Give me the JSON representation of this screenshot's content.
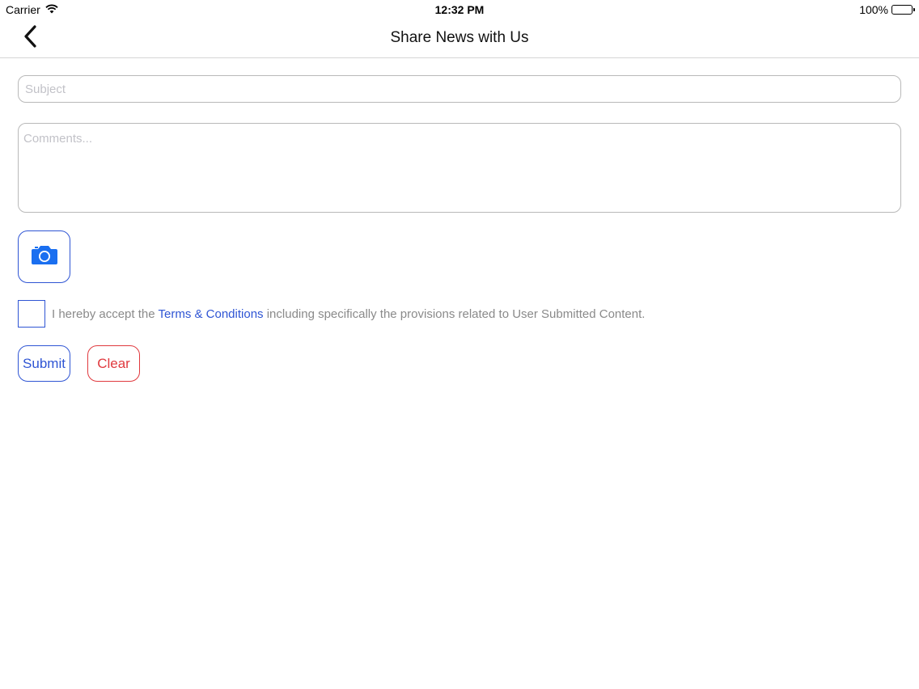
{
  "status_bar": {
    "carrier": "Carrier",
    "time": "12:32 PM",
    "battery": "100%",
    "battery_level": 1.0
  },
  "nav": {
    "title": "Share News with Us",
    "back_icon": "chevron-left-icon"
  },
  "form": {
    "subject_placeholder": "Subject",
    "subject_value": "",
    "comments_placeholder": "Comments...",
    "comments_value": "",
    "camera_icon": "camera-icon",
    "terms_prefix": "I hereby accept the ",
    "terms_link": "Terms & Conditions",
    "terms_suffix": " including specifically the provisions related to User Submitted Content.",
    "terms_checked": false,
    "submit_label": "Submit",
    "clear_label": "Clear"
  },
  "colors": {
    "accent": "#2f55d4",
    "danger": "#e0393e",
    "camera_icon": "#1a6ff0"
  }
}
